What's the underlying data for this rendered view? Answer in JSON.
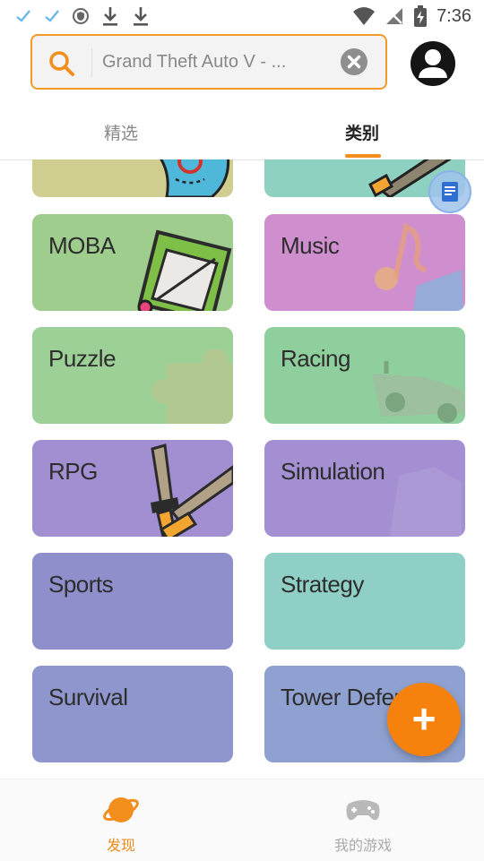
{
  "status_bar": {
    "time": "7:36"
  },
  "search": {
    "value": "Grand Theft Auto V - ..."
  },
  "tabs": [
    {
      "label": "精选"
    },
    {
      "label": "类别"
    }
  ],
  "categories": [
    {
      "label": "MOBA",
      "color": "#9fcd8e"
    },
    {
      "label": "Music",
      "color": "#cf8fcf"
    },
    {
      "label": "Puzzle",
      "color": "#9dd096"
    },
    {
      "label": "Racing",
      "color": "#8fcf9e"
    },
    {
      "label": "RPG",
      "color": "#a18fd2"
    },
    {
      "label": "Simulation",
      "color": "#a38fd1"
    },
    {
      "label": "Sports",
      "color": "#8f8fcc"
    },
    {
      "label": "Strategy",
      "color": "#8fcfc6"
    },
    {
      "label": "Survival",
      "color": "#8f96ce"
    },
    {
      "label": "Tower Defen",
      "color": "#8fa1d0"
    }
  ],
  "fab": {
    "label": "+"
  },
  "bottom_nav": [
    {
      "label": "发现"
    },
    {
      "label": "我的游戏"
    }
  ],
  "colors": {
    "accent": "#f39a2b",
    "fab": "#f6820d"
  }
}
